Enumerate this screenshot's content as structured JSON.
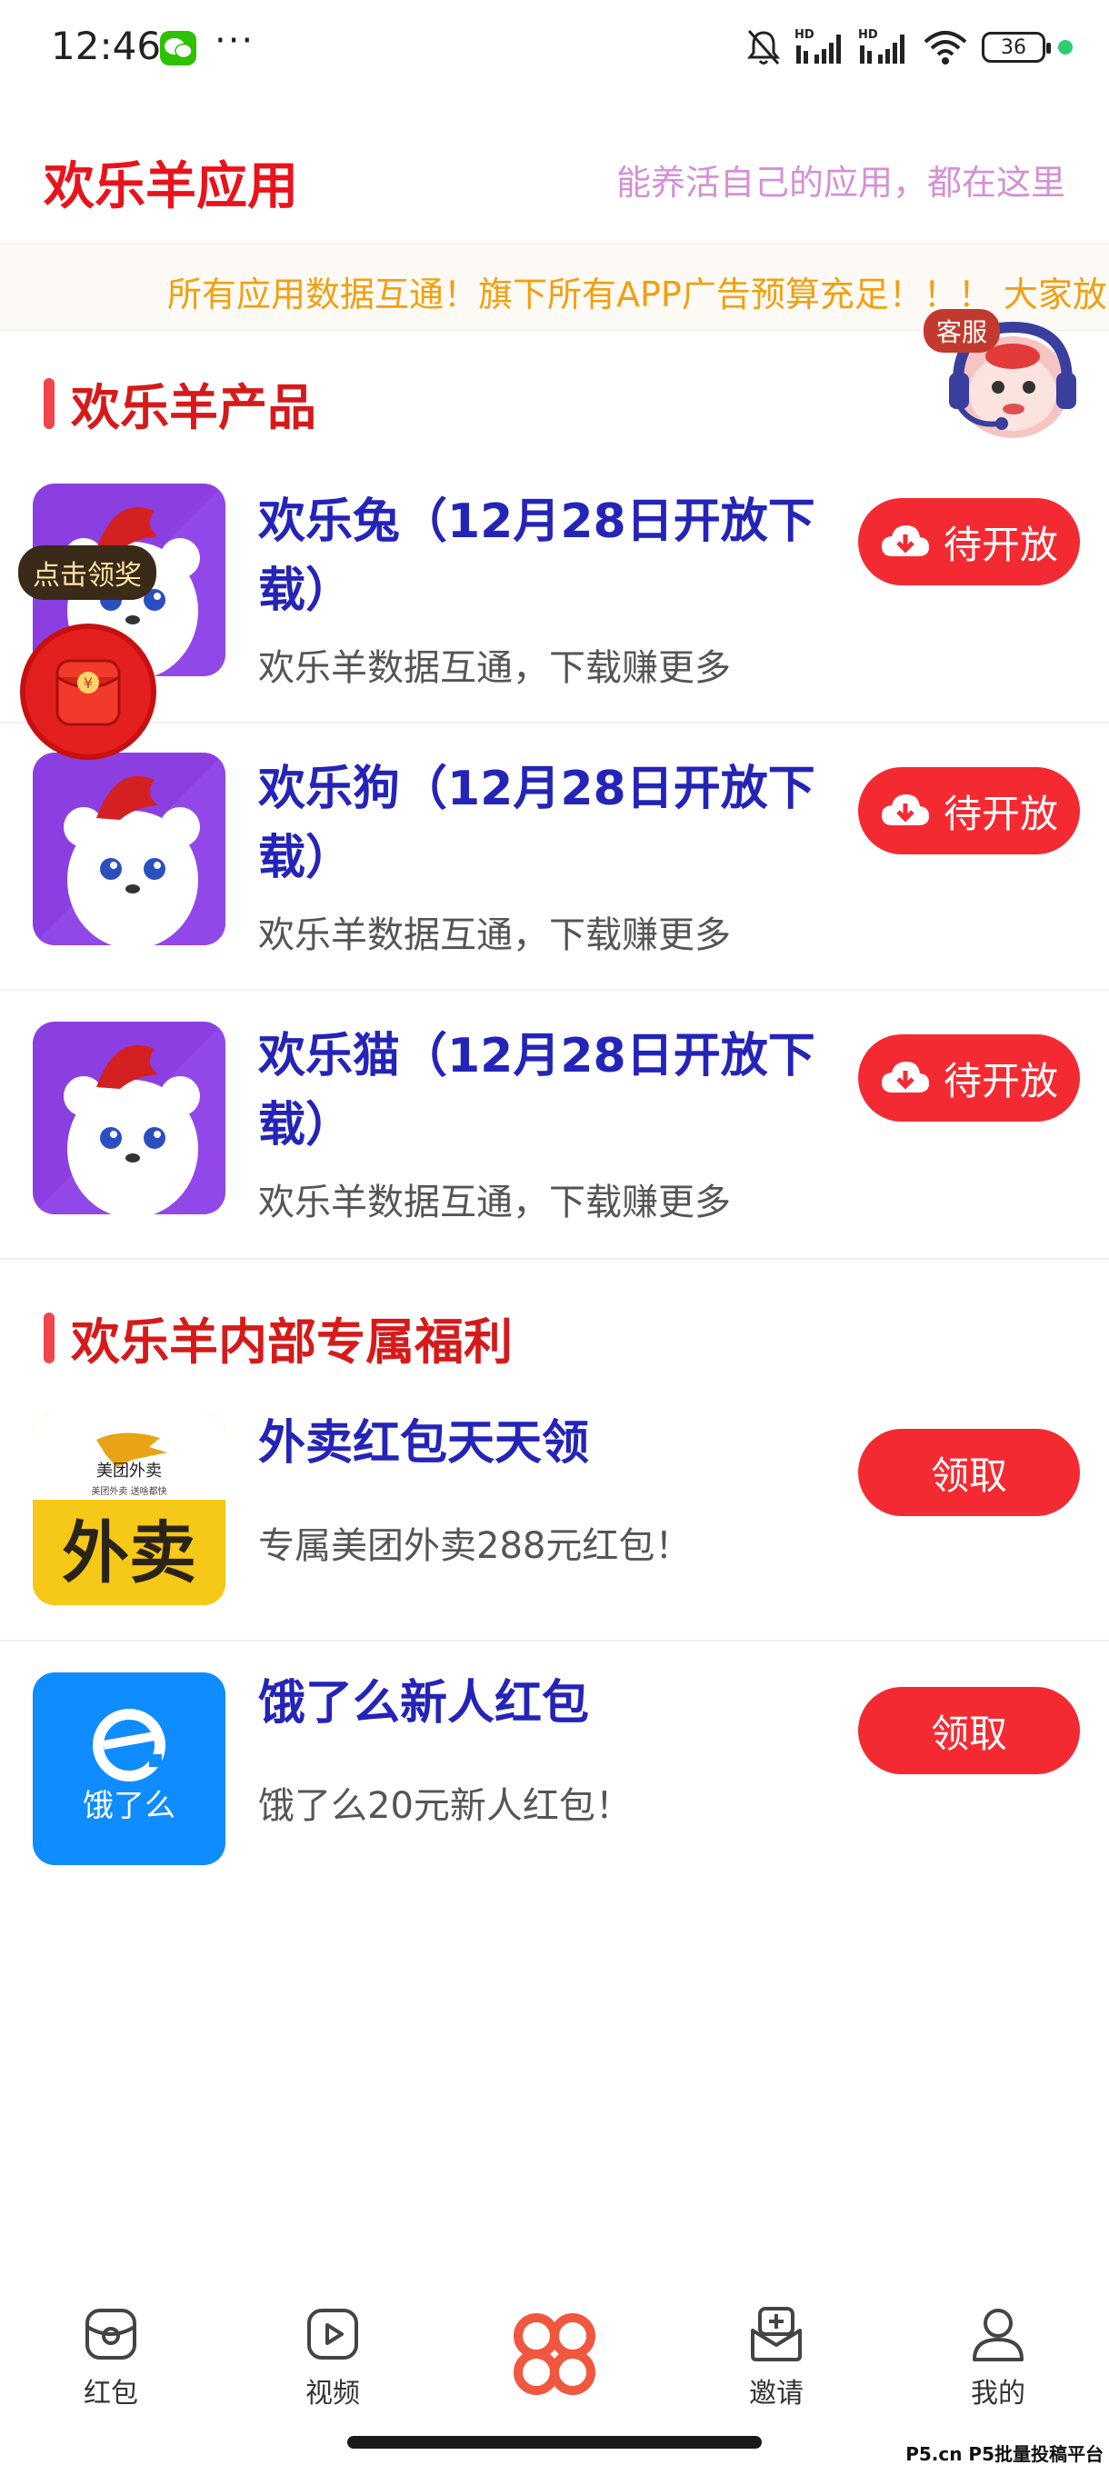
{
  "status_bar": {
    "time": "12:46",
    "more": "···",
    "hd1": "HD",
    "hd2": "HD",
    "battery": "36"
  },
  "header": {
    "title": "欢乐羊应用",
    "subtitle": "能养活自己的应用，都在这里"
  },
  "marquee": {
    "text": "所有应用数据互通！旗下所有APP广告预算充足！！！ 大家放心"
  },
  "floating": {
    "customer_service": "客服",
    "reward": "点击领奖"
  },
  "products": {
    "title": "欢乐羊产品",
    "items": [
      {
        "name": "欢乐兔（12月28日开放下载）",
        "desc": "欢乐羊数据互通，下载赚更多",
        "button": "待开放"
      },
      {
        "name": "欢乐狗（12月28日开放下载）",
        "desc": "欢乐羊数据互通，下载赚更多",
        "button": "待开放"
      },
      {
        "name": "欢乐猫（12月28日开放下载）",
        "desc": "欢乐羊数据互通，下载赚更多",
        "button": "待开放"
      }
    ]
  },
  "benefits": {
    "title": "欢乐羊内部专属福利",
    "items": [
      {
        "name": "外卖红包天天领",
        "desc": "专属美团外卖288元红包！",
        "button": "领取",
        "icon_top": "美团外卖",
        "icon_sub": "美团外卖 送啥都快",
        "icon_big": "外卖"
      },
      {
        "name": "饿了么新人红包",
        "desc": "饿了么20元新人红包！",
        "button": "领取",
        "icon_text": "饿了么"
      }
    ]
  },
  "nav": {
    "items": [
      {
        "label": "红包"
      },
      {
        "label": "视频"
      },
      {
        "label": ""
      },
      {
        "label": "邀请"
      },
      {
        "label": "我的"
      }
    ]
  },
  "watermark": "P5.cn P5批量投稿平台",
  "colors": {
    "brand_red": "#e8131b",
    "button_red": "#f32a32",
    "title_blue": "#2424b8",
    "marquee_orange": "#f0a010"
  }
}
